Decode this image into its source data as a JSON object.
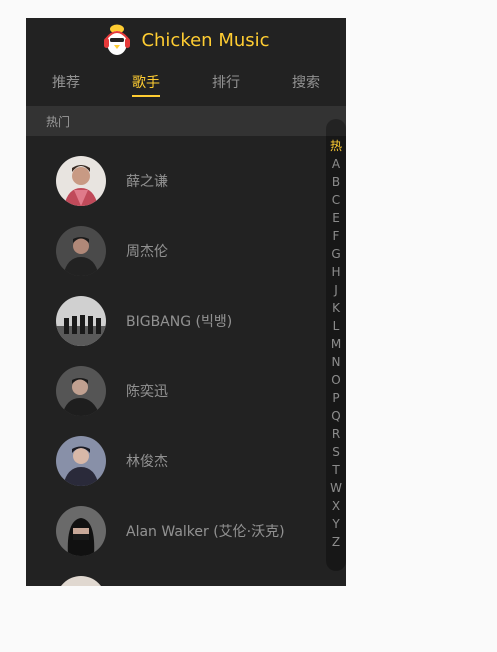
{
  "header": {
    "title": "Chicken Music",
    "logo_icon": "chicken-headphones-icon"
  },
  "tabs": [
    {
      "label": "推荐"
    },
    {
      "label": "歌手",
      "active": true
    },
    {
      "label": "排行"
    },
    {
      "label": "搜索"
    }
  ],
  "group": {
    "title": "热门"
  },
  "singers": [
    {
      "name": "薛之谦"
    },
    {
      "name": "周杰伦"
    },
    {
      "name": "BIGBANG (빅뱅)"
    },
    {
      "name": "陈奕迅"
    },
    {
      "name": "林俊杰"
    },
    {
      "name": "Alan Walker (艾伦·沃克)"
    },
    {
      "name": ""
    }
  ],
  "shortcut": {
    "items": [
      "热",
      "A",
      "B",
      "C",
      "E",
      "F",
      "G",
      "H",
      "J",
      "K",
      "L",
      "M",
      "N",
      "O",
      "P",
      "Q",
      "R",
      "S",
      "T",
      "W",
      "X",
      "Y",
      "Z"
    ],
    "current_index": 0
  },
  "colors": {
    "accent": "#ffcd32",
    "background": "#222222",
    "group_background": "#333333",
    "page_background": "#fafafa"
  }
}
